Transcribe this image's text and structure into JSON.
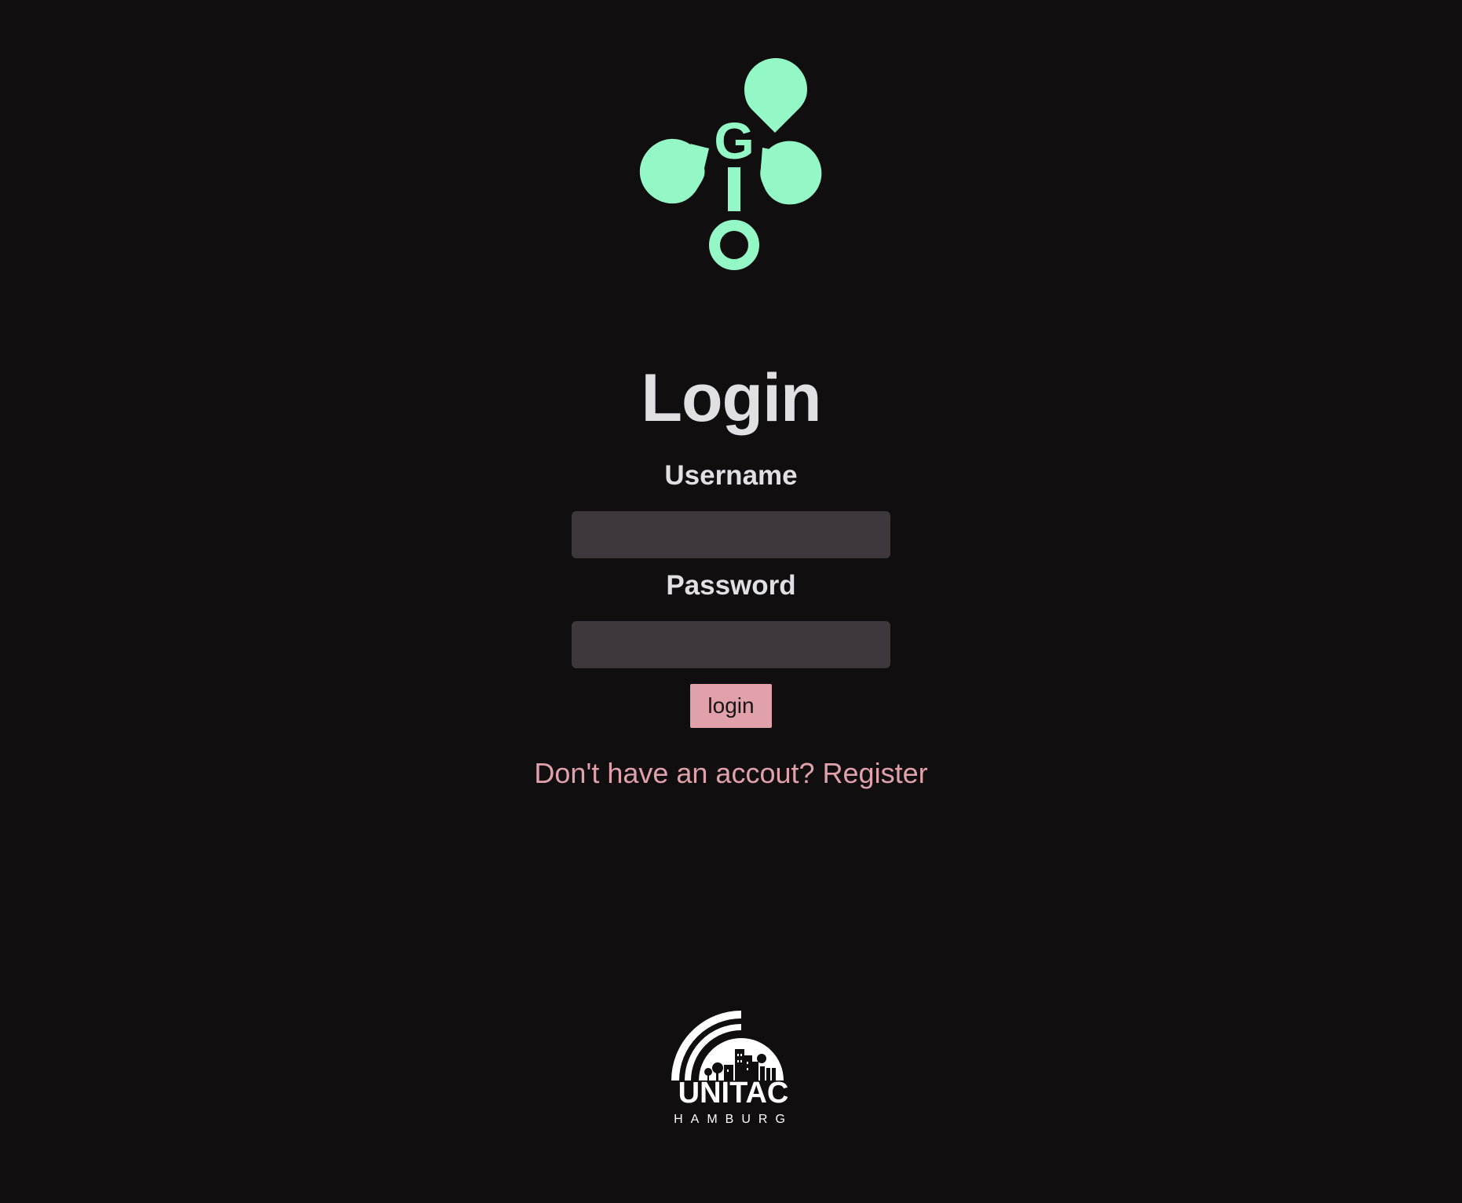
{
  "logo": {
    "brand_color": "#94f7c6",
    "letters": [
      "G",
      "I",
      "O"
    ],
    "icon": "gio-droplets-logo"
  },
  "login": {
    "title": "Login",
    "username_label": "Username",
    "username_value": "",
    "password_label": "Password",
    "password_value": "",
    "submit_label": "login",
    "register_link": "Don't have an accout? Register"
  },
  "colors": {
    "background": "#100e0f",
    "accent": "#e0a1aa",
    "input_background": "#3e383e",
    "text": "#e0dfe4"
  },
  "footer": {
    "partner_name": "UNITAC",
    "partner_city": "HAMBURG",
    "icon": "unitac-hamburg-logo"
  }
}
